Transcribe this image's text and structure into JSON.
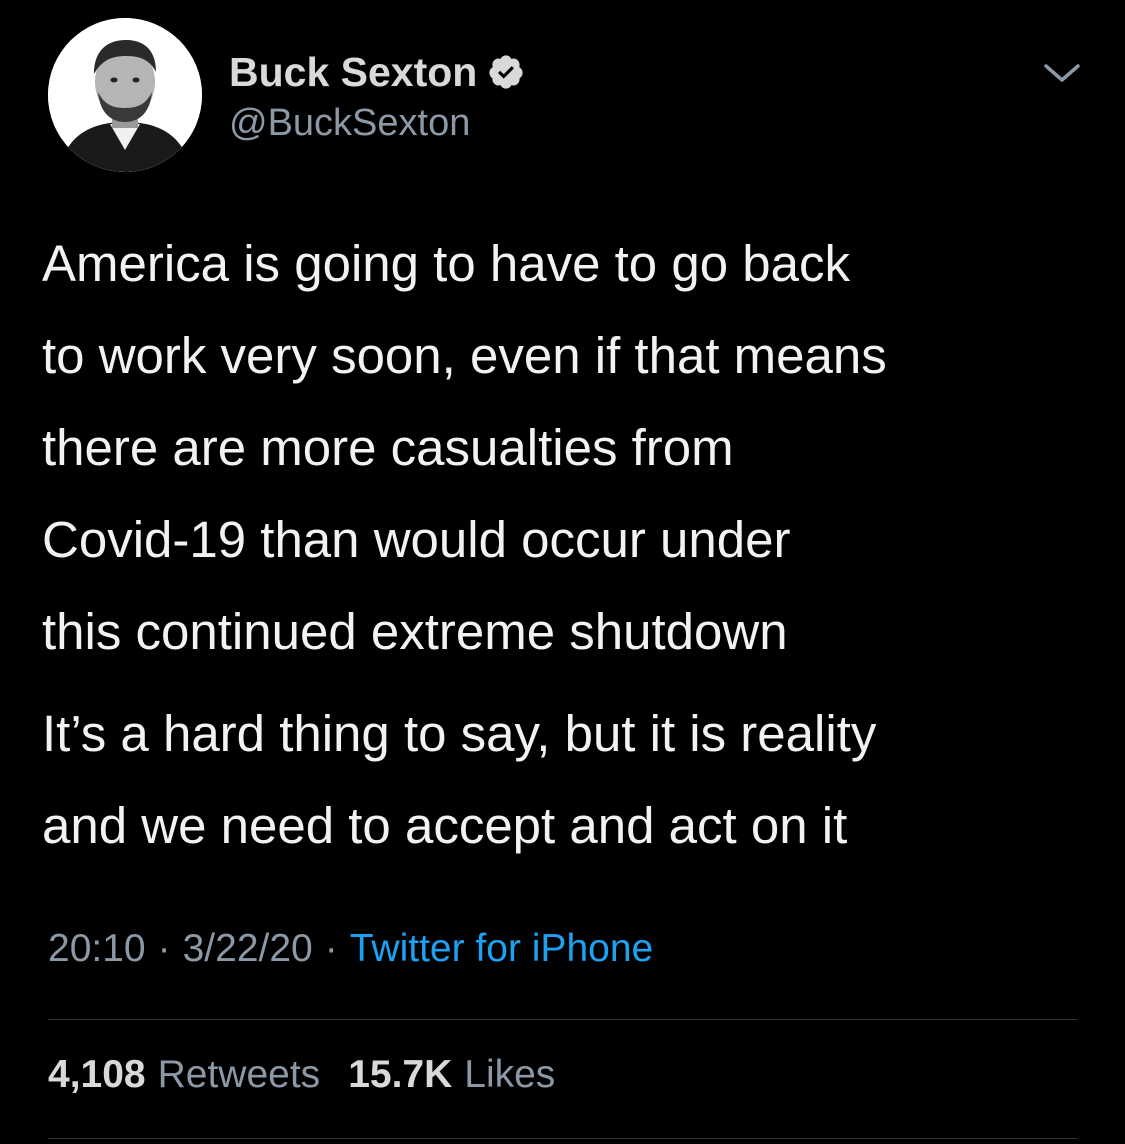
{
  "author": {
    "display_name": "Buck Sexton",
    "handle": "@BuckSexton",
    "verified": true,
    "avatar_icon": "profile-photo"
  },
  "tweet": {
    "paragraphs": [
      "America is going to have to go back\nto work very soon, even if that means\nthere are more casualties from\nCovid-19 than would occur under\nthis continued extreme shutdown",
      "It’s a hard thing to say, but it is reality\nand we need to accept and act on it"
    ],
    "time": "20:10",
    "date": "3/22/20",
    "separator": "·",
    "source": "Twitter for iPhone"
  },
  "stats": {
    "retweets_count": "4,108",
    "retweets_label": "Retweets",
    "likes_count": "15.7K",
    "likes_label": "Likes"
  },
  "colors": {
    "background": "#000000",
    "text": "#f2f2f2",
    "secondary": "#8b98a5",
    "link": "#1da1f2",
    "divider": "#2f3336"
  }
}
